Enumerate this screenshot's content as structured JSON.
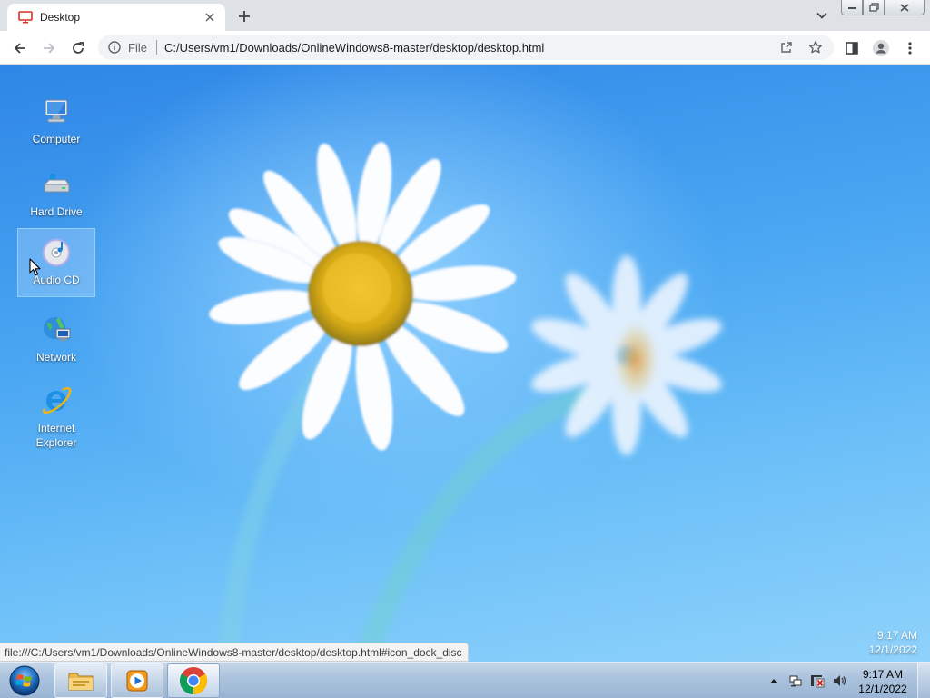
{
  "browser": {
    "tab": {
      "title": "Desktop",
      "favicon": "monitor-icon"
    },
    "address": {
      "scheme_label": "File",
      "url": "C:/Users/vm1/Downloads/OnlineWindows8-master/desktop/desktop.html"
    },
    "status_url": "file:///C:/Users/vm1/Downloads/OnlineWindows8-master/desktop/desktop.html#icon_dock_disc"
  },
  "desktop": {
    "icons": [
      {
        "label": "Computer",
        "icon": "computer-icon",
        "selected": false
      },
      {
        "label": "Hard Drive",
        "icon": "hard-drive-icon",
        "selected": false
      },
      {
        "label": "Audio CD",
        "icon": "audio-cd-icon",
        "selected": true
      },
      {
        "label": "Network",
        "icon": "network-icon",
        "selected": false
      },
      {
        "label": "Internet Explorer",
        "icon": "internet-explorer-icon",
        "selected": false
      }
    ],
    "clock": {
      "time": "9:17 AM",
      "date": "12/1/2022"
    }
  },
  "taskbar": {
    "apps": [
      {
        "name": "File Explorer",
        "icon": "folder-icon",
        "active": false
      },
      {
        "name": "Media Player",
        "icon": "media-player-icon",
        "active": false
      },
      {
        "name": "Chrome",
        "icon": "chrome-icon",
        "active": true
      }
    ],
    "clock": {
      "time": "9:17 AM",
      "date": "12/1/2022"
    }
  },
  "colors": {
    "accent": "#1a73e8",
    "desktop_top": "#2e86e6",
    "desktop_bottom": "#8fd2fb",
    "taskbar": "#aac2dd"
  }
}
